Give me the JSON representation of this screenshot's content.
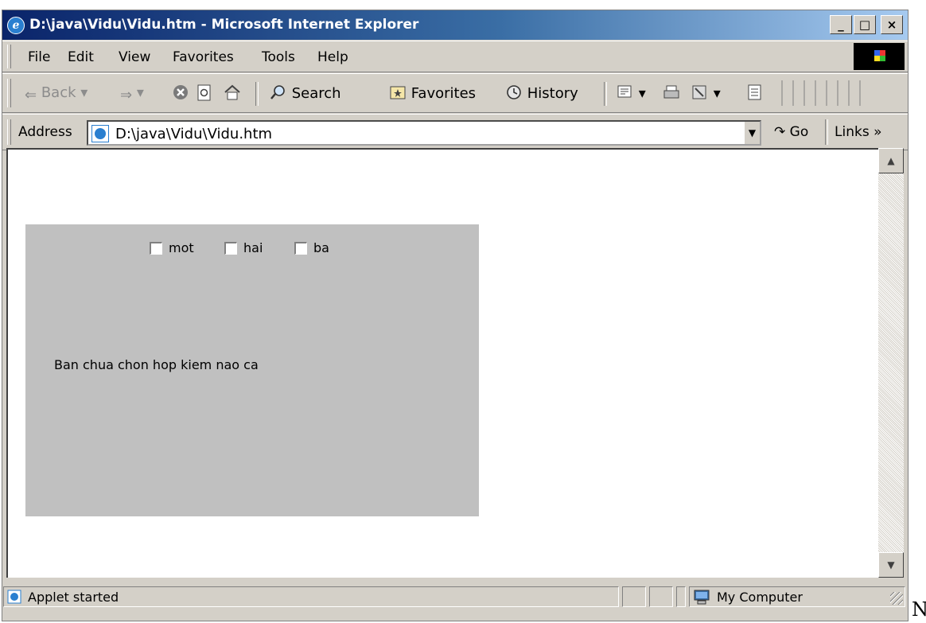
{
  "window": {
    "title": "D:\\java\\Vidu\\Vidu.htm - Microsoft Internet Explorer",
    "icon": "ie-icon",
    "controls": {
      "minimize": "_",
      "maximize": "□",
      "close": "×"
    }
  },
  "menu": {
    "items": [
      {
        "label": "File"
      },
      {
        "label": "Edit"
      },
      {
        "label": "View"
      },
      {
        "label": "Favorites"
      },
      {
        "label": "Tools"
      },
      {
        "label": "Help"
      }
    ]
  },
  "toolbar": {
    "back": "Back",
    "search": "Search",
    "favorites": "Favorites",
    "history": "History"
  },
  "address": {
    "label": "Address",
    "value": "D:\\java\\Vidu\\Vidu.htm",
    "go": "Go",
    "links": "Links"
  },
  "applet": {
    "background": "#c0c0c0",
    "checkboxes": [
      {
        "label": "mot",
        "checked": false
      },
      {
        "label": "hai",
        "checked": false
      },
      {
        "label": "ba",
        "checked": false
      }
    ],
    "message": "Ban chua chon hop kiem nao ca"
  },
  "status": {
    "text": "Applet started",
    "zone": "My Computer"
  },
  "trailing_text": "N"
}
